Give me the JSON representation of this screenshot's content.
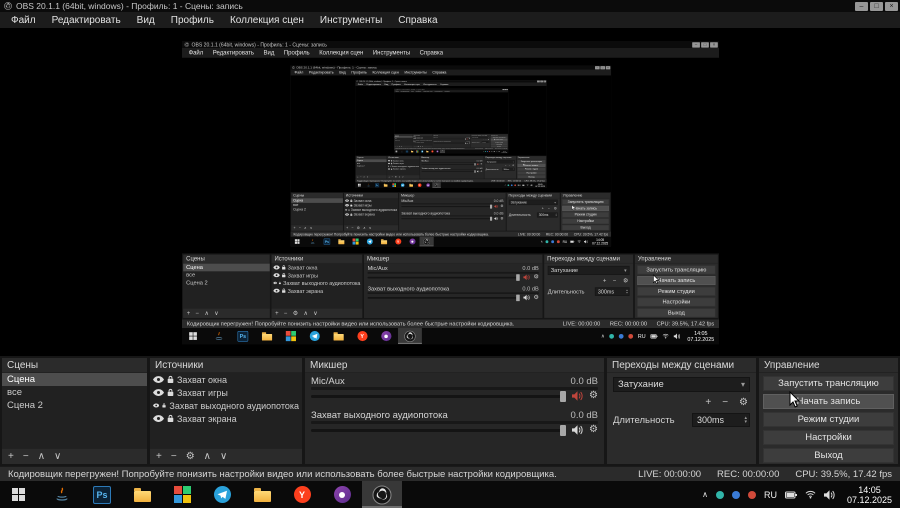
{
  "window": {
    "title": "OBS 20.1.1 (64bit, windows) - Профиль: 1 - Сцены: запись"
  },
  "menu": {
    "items": [
      "Файл",
      "Редактировать",
      "Вид",
      "Профиль",
      "Коллекция сцен",
      "Инструменты",
      "Справка"
    ]
  },
  "docks": {
    "scenes": {
      "title": "Сцены",
      "items": [
        "Сцена",
        "все",
        "Сцена 2"
      ],
      "selected_index": 0
    },
    "sources": {
      "title": "Источники",
      "items": [
        "Захват окна",
        "Захват игры",
        "Захват выходного аудиопотока",
        "Захват экрана"
      ]
    },
    "mixer": {
      "title": "Микшер",
      "channels": [
        {
          "name": "Mic/Aux",
          "level": "0.0 dB",
          "muted": true
        },
        {
          "name": "Захват выходного аудиопотока",
          "level": "0.0 dB",
          "muted": false
        }
      ]
    },
    "transitions": {
      "title": "Переходы между сценами",
      "current": "Затухание",
      "duration_label": "Длительность",
      "duration_value": "300ms"
    },
    "controls": {
      "title": "Управление",
      "buttons": [
        "Запустить трансляцию",
        "Начать запись",
        "Режим студии",
        "Настройки",
        "Выход"
      ]
    }
  },
  "statusbar": {
    "message": "Кодировщик перегружен! Попробуйте понизить настройки видео или использовать более быстрые настройки кодировщика.",
    "live": "LIVE: 00:00:00",
    "rec": "REC: 00:00:00",
    "cpu": "CPU: 39.5%, 17.42 fps"
  },
  "taskbar": {
    "language": "RU",
    "time": "14:05",
    "date": "07.12.2025"
  },
  "icons": {
    "minimize": "–",
    "maximize": "□",
    "close": "×",
    "plus": "+",
    "minus": "−",
    "up": "∧",
    "down": "∨",
    "gear": "⚙",
    "dropdown": "▾",
    "spin_up": "▴",
    "spin_down": "▾",
    "photoshop": "Ps",
    "yandex": "Y"
  },
  "colors": {
    "muted_speaker": "#c0453c",
    "selected_item": "#4d4d4d",
    "active_task_highlight": "#383838"
  }
}
